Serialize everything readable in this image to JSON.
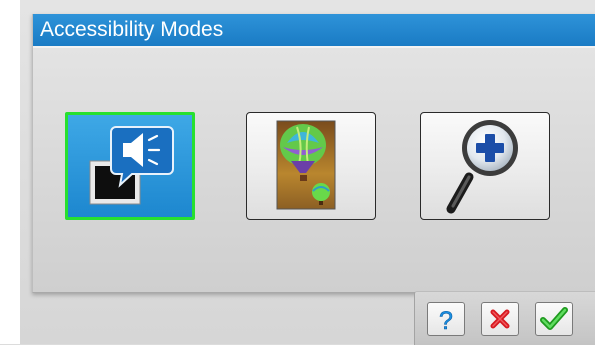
{
  "window": {
    "title": "Accessibility Modes"
  },
  "modes": [
    {
      "name": "audio-description",
      "icon": "speaker-speech-bubble-icon",
      "selected": true
    },
    {
      "name": "high-contrast",
      "icon": "hot-air-balloon-image-icon",
      "selected": false
    },
    {
      "name": "magnifier",
      "icon": "magnifying-glass-plus-icon",
      "selected": false
    }
  ],
  "toolbar": {
    "help_icon": "question-mark-icon",
    "cancel_icon": "red-x-icon",
    "confirm_icon": "green-checkmark-icon",
    "help_glyph": "?"
  },
  "colors": {
    "title_bar": "#1f86cf",
    "selection_border": "#27e02f",
    "help": "#1a8fe0",
    "cancel": "#d71920",
    "confirm": "#2fbf2f"
  }
}
